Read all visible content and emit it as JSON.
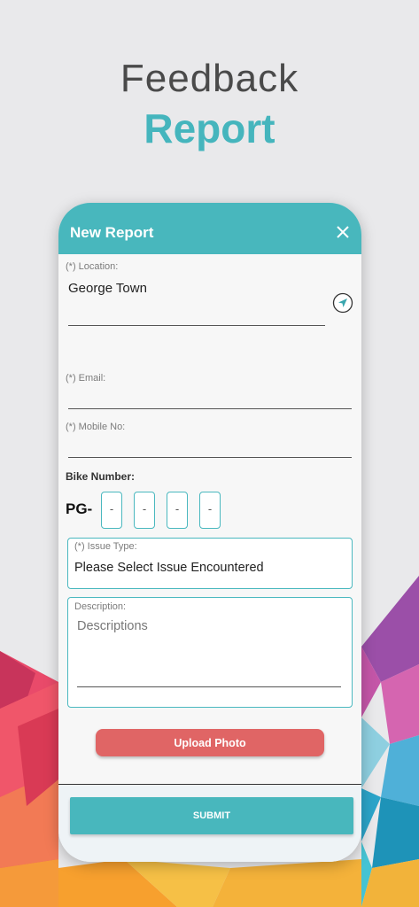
{
  "hero": {
    "title": "Feedback",
    "subtitle": "Report"
  },
  "dialog": {
    "title": "New Report",
    "close_icon": "close-icon",
    "location": {
      "label": "(*) Location:",
      "value": "George Town",
      "icon": "navigation-arrow-icon"
    },
    "email": {
      "label": "(*) Email:",
      "value": ""
    },
    "mobile": {
      "label": "(*) Mobile No:",
      "value": ""
    },
    "bike_number": {
      "label": "Bike Number:",
      "prefix": "PG-",
      "segments": [
        "-",
        "-",
        "-",
        "-"
      ]
    },
    "issue_type": {
      "label": "(*) Issue Type:",
      "value": "Please Select Issue Encountered"
    },
    "description": {
      "label": "Description:",
      "placeholder": "Descriptions"
    },
    "upload_label": "Upload Photo",
    "submit_label": "SUBMIT"
  },
  "colors": {
    "accent": "#48b7bd",
    "upload": "#e06565",
    "background": "#e9e9eb"
  }
}
